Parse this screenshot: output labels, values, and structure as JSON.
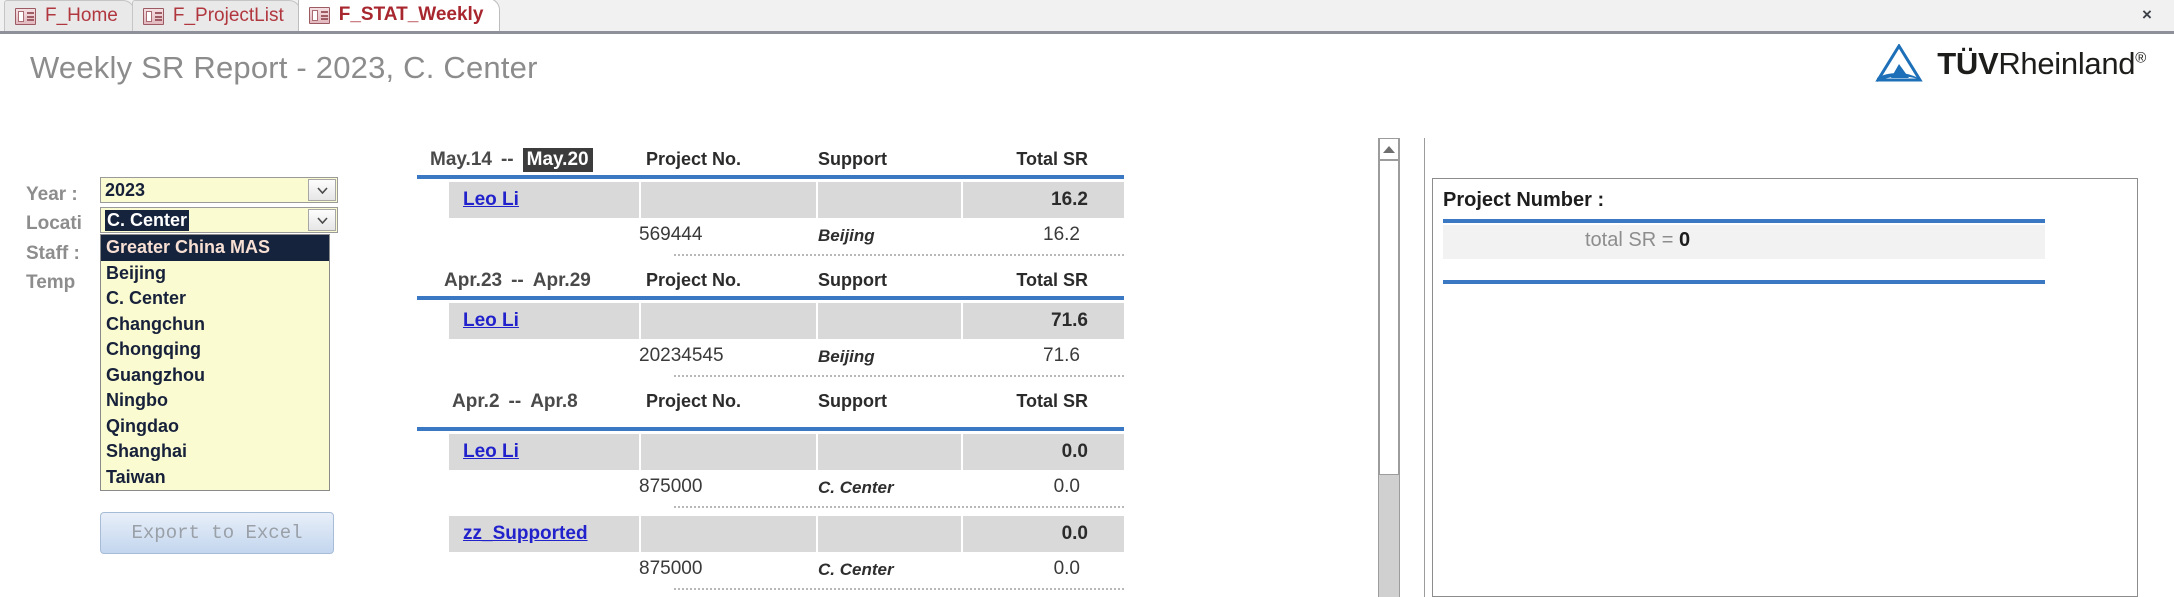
{
  "window": {
    "close_label": "×",
    "tabs": [
      {
        "label": "F_Home",
        "active": false,
        "icon": "form-icon"
      },
      {
        "label": "F_ProjectList",
        "active": false,
        "icon": "form-icon"
      },
      {
        "label": "F_STAT_Weekly",
        "active": true,
        "icon": "form-icon"
      }
    ]
  },
  "header": {
    "title": "Weekly SR Report - 2023, C. Center",
    "logo_text_bold": "TÜV",
    "logo_text_regular": "Rheinland",
    "logo_registered": "®",
    "logo_color": "#1d70b8"
  },
  "filters": {
    "year_label": "Year :",
    "location_label": "Locati",
    "staff_label": "Staff :",
    "temp_label": "Temp",
    "year_value": "2023",
    "location_value": "C. Center",
    "dropdown_open": true,
    "dropdown_options": [
      "Greater China MAS",
      "Beijing",
      "C. Center",
      "Changchun",
      "Chongqing",
      "Guangzhou",
      "Ningbo",
      "Qingdao",
      "Shanghai",
      "Taiwan"
    ],
    "dropdown_highlighted_index": 0,
    "export_label": "Export to Excel"
  },
  "report": {
    "columns": [
      "Project No.",
      "Support",
      "Total SR"
    ],
    "groups": [
      {
        "date_from": "May.14",
        "date_sep": "--",
        "date_to": "May.20",
        "date_to_selected": true,
        "staff_rows": [
          {
            "staff": "Leo Li",
            "staff_total": "16.2",
            "details": [
              {
                "project_no": "569444",
                "support": "Beijing",
                "total_sr": "16.2"
              }
            ]
          }
        ]
      },
      {
        "date_from": "Apr.23",
        "date_sep": "--",
        "date_to": "Apr.29",
        "date_to_selected": false,
        "staff_rows": [
          {
            "staff": "Leo Li",
            "staff_total": "71.6",
            "details": [
              {
                "project_no": "20234545",
                "support": "Beijing",
                "total_sr": "71.6"
              }
            ]
          }
        ]
      },
      {
        "date_from": "Apr.2",
        "date_sep": "--",
        "date_to": "Apr.8",
        "date_to_selected": false,
        "staff_rows": [
          {
            "staff": "Leo Li",
            "staff_total": "0.0",
            "details": [
              {
                "project_no": "875000",
                "support": "C. Center",
                "total_sr": "0.0"
              }
            ]
          },
          {
            "staff": "zz_Supported",
            "staff_total": "0.0",
            "details": [
              {
                "project_no": "875000",
                "support": "C. Center",
                "total_sr": "0.0"
              }
            ]
          }
        ]
      }
    ]
  },
  "right_panel": {
    "title": "Project Number :",
    "total_label": "total SR =",
    "total_value": "0"
  },
  "colors": {
    "rule_blue": "#3b78c3",
    "tab_red": "#a8272f",
    "combo_yellow": "#fbfbd2",
    "selection_navy": "#16233c"
  }
}
